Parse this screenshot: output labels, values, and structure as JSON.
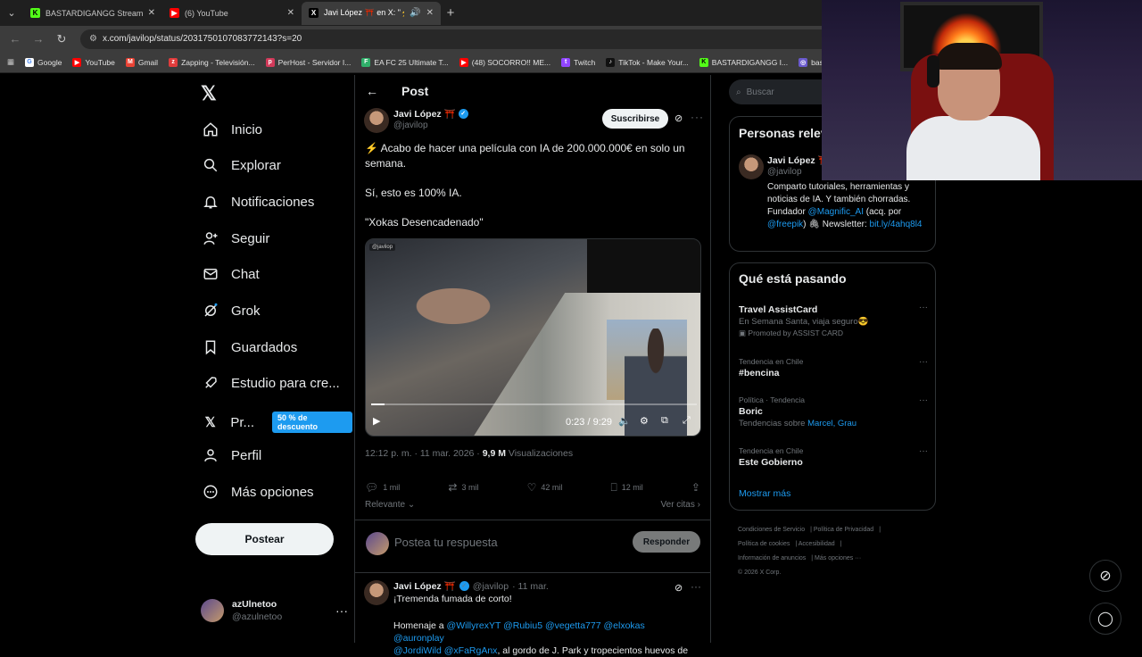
{
  "browser": {
    "tabs": [
      {
        "title": "BASTARDIGANGG Stream - Wa",
        "fav_color": "#53fc18",
        "fav_glyph": "K"
      },
      {
        "title": "(6) YouTube",
        "fav_color": "#ff0000",
        "fav_glyph": "▶"
      },
      {
        "title": "Javi López ⛩️ en X: \"⚡ Ac",
        "fav_color": "#000000",
        "fav_glyph": "X"
      }
    ],
    "url": "x.com/javilop/status/2031750107083772143?s=20",
    "bookmarks": [
      {
        "label": "Google",
        "color": "#ffffff"
      },
      {
        "label": "YouTube",
        "color": "#ff0000"
      },
      {
        "label": "Gmail",
        "color": "#ea4335"
      },
      {
        "label": "Zapping - Televisión...",
        "color": "#e03c3c"
      },
      {
        "label": "PerHost - Servidor I...",
        "color": "#d23a5a"
      },
      {
        "label": "EA FC 25 Ultimate T...",
        "color": "#2fb06a"
      },
      {
        "label": "(48) SOCORRO!! ME...",
        "color": "#ff0000"
      },
      {
        "label": "Twitch",
        "color": "#9146ff"
      },
      {
        "label": "TikTok - Make Your...",
        "color": "#111111"
      },
      {
        "label": "BASTARDIGANGG I...",
        "color": "#53fc18"
      },
      {
        "label": "bastardigangg",
        "color": "#6a5acd"
      }
    ]
  },
  "nav": {
    "items": [
      {
        "label": "Inicio",
        "icon": "home-icon"
      },
      {
        "label": "Explorar",
        "icon": "search-icon"
      },
      {
        "label": "Notificaciones",
        "icon": "bell-icon"
      },
      {
        "label": "Seguir",
        "icon": "follow-icon"
      },
      {
        "label": "Chat",
        "icon": "mail-icon"
      },
      {
        "label": "Grok",
        "icon": "grok-icon"
      },
      {
        "label": "Guardados",
        "icon": "bookmark-icon"
      },
      {
        "label": "Estudio para cre...",
        "icon": "rocket-icon"
      },
      {
        "label": "Pr...",
        "icon": "x-icon"
      },
      {
        "label": "Perfil",
        "icon": "person-icon"
      },
      {
        "label": "Más opciones",
        "icon": "more-circle-icon"
      }
    ],
    "premium_badge": "50 % de descuento",
    "post_button": "Postear",
    "profile": {
      "name": "azUlnetoo",
      "handle": "@azulnetoo"
    }
  },
  "post": {
    "header": "Post",
    "author": {
      "name": "Javi López ⛩️",
      "handle": "@javilop"
    },
    "subscribe": "Suscribirse",
    "text": [
      "⚡ Acabo de hacer una película con IA de 200.000.000€ en solo un semana.",
      "Sí, esto es 100% IA.",
      "\"Xokas Desencadenado\""
    ],
    "video": {
      "watermark": "@javilop",
      "time": "0:23 / 9:29",
      "progress": 0.04
    },
    "meta_time": "12:12 p. m. · 11 mar. 2026 · ",
    "views_value": "9,9 M",
    "views_label": " Visualizaciones",
    "actions": {
      "replies": "1 mil",
      "reposts": "3 mil",
      "likes": "42 mil",
      "bookmarks": "12 mil"
    },
    "sort": "Relevante",
    "quotes": "Ver citas",
    "reply_placeholder": "Postea tu respuesta",
    "reply_button": "Responder"
  },
  "reply": {
    "name": "Javi López ⛩️",
    "handle": "@javilop",
    "date": "· 11 mar.",
    "line1": "¡Tremenda fumada de corto!",
    "body_prefix": "Homenaje a ",
    "mentions1": "@WillyrexYT @Rubiu5 @vegetta777 @elxokas @auronplay",
    "mentions2": "@JordiWild @xFaRgAnx",
    "body_suffix": ", al gordo de J. Park y tropecientos huevos de"
  },
  "right": {
    "search_placeholder": "Buscar",
    "relevant_title": "Personas relevantes",
    "relevant_person": {
      "name": "Javi López ⛩️",
      "handle": "@javilop",
      "bio1": "Comparto tutoriales, herramientas y noticias de IA. Y también chorradas. Fundador ",
      "bio_link1": "@Magnific_AI",
      "bio2": " (acq. por ",
      "bio_link2": "@freepik",
      "bio3": ") 🖇 Newsletter: ",
      "bio_link3": "bit.ly/4ahq8l4"
    },
    "trending_title": "Qué está pasando",
    "trends": [
      {
        "cat": "",
        "title": "Travel AssistCard",
        "sub": "En Semana Santa, viaja seguro😎",
        "extra": "Promoted by ASSIST CARD"
      },
      {
        "cat": "Tendencia en Chile",
        "title": "#bencina",
        "sub": "",
        "extra": ""
      },
      {
        "cat": "Política · Tendencia",
        "title": "Boric",
        "sub": "Tendencias sobre ",
        "extra": "Marcel, Grau"
      },
      {
        "cat": "Tendencia en Chile",
        "title": "Este Gobierno",
        "sub": "",
        "extra": ""
      }
    ],
    "show_more": "Mostrar más",
    "footer": [
      "Condiciones de Servicio",
      "Política de Privacidad",
      "Política de cookies",
      "Accesibilidad",
      "Información de anuncios",
      "Más opciones ···",
      "© 2026 X Corp."
    ]
  },
  "colors": {
    "accent": "#1d9bf0",
    "background": "#000000",
    "border": "#2f3336"
  }
}
